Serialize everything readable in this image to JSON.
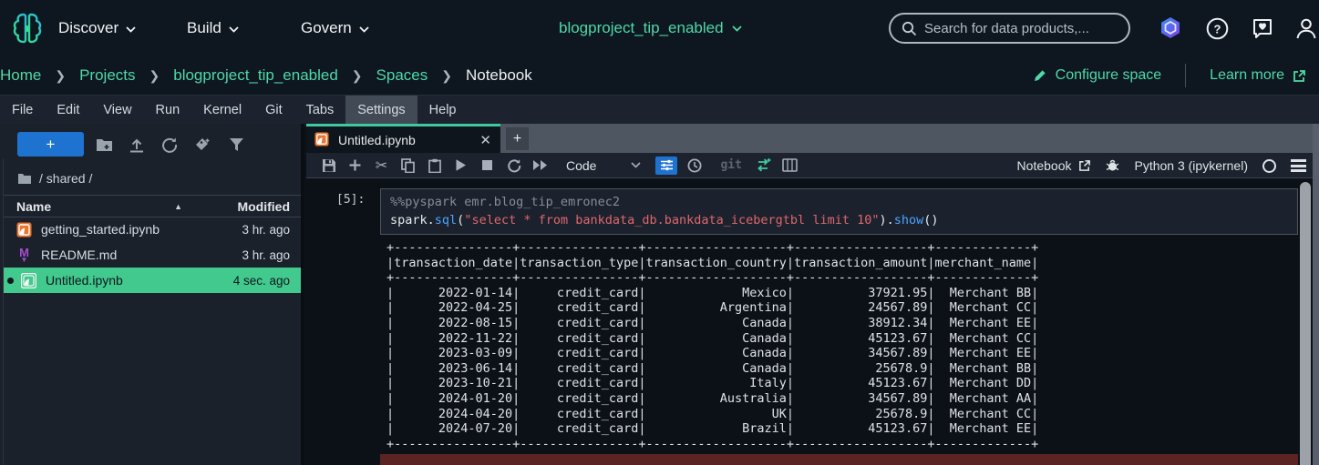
{
  "topnav": {
    "menus": [
      {
        "label": "Discover"
      },
      {
        "label": "Build"
      },
      {
        "label": "Govern"
      }
    ],
    "project_selector": "blogproject_tip_enabled",
    "search_placeholder": "Search for data products,...",
    "accent_color": "#4ed9a8"
  },
  "breadcrumb": {
    "items": [
      "Home",
      "Projects",
      "blogproject_tip_enabled",
      "Spaces",
      "Notebook"
    ],
    "configure_label": "Configure space",
    "learn_more_label": "Learn more"
  },
  "menubar": {
    "items": [
      "File",
      "Edit",
      "View",
      "Run",
      "Kernel",
      "Git",
      "Tabs",
      "Settings",
      "Help"
    ],
    "active_item": "Settings"
  },
  "sidebar": {
    "new_button_label": "+",
    "path": "/ shared /",
    "columns": {
      "name": "Name",
      "modified": "Modified"
    },
    "files": [
      {
        "name": "getting_started.ipynb",
        "modified": "3 hr. ago",
        "type": "notebook",
        "selected": false
      },
      {
        "name": "README.md",
        "modified": "3 hr. ago",
        "type": "markdown",
        "selected": false
      },
      {
        "name": "Untitled.ipynb",
        "modified": "4 sec. ago",
        "type": "notebook",
        "selected": true,
        "unsaved": true
      }
    ]
  },
  "editor": {
    "tab_title": "Untitled.ipynb",
    "cell_type_selector": "Code",
    "git_label": "git",
    "notebook_link_label": "Notebook",
    "kernel_name": "Python 3 (ipykernel)"
  },
  "cell": {
    "execution_count": "[5]:",
    "magic_line": "%%pyspark emr.blog_tip_emronec2",
    "tokens": [
      {
        "text": "spark",
        "type": "plain"
      },
      {
        "text": ".",
        "type": "plain"
      },
      {
        "text": "sql",
        "type": "fn"
      },
      {
        "text": "(",
        "type": "plain"
      },
      {
        "text": "\"select * from bankdata_db.bankdata_icebergtbl limit 10\"",
        "type": "str"
      },
      {
        "text": ")",
        "type": "plain"
      },
      {
        "text": ".",
        "type": "plain"
      },
      {
        "text": "show",
        "type": "fn"
      },
      {
        "text": "()",
        "type": "plain"
      }
    ]
  },
  "output_table": {
    "columns": [
      "transaction_date",
      "transaction_type",
      "transaction_country",
      "transaction_amount",
      "merchant_name"
    ],
    "rows": [
      [
        "2022-01-14",
        "credit_card",
        "Mexico",
        "37921.95",
        "Merchant BB"
      ],
      [
        "2022-04-25",
        "credit_card",
        "Argentina",
        "24567.89",
        "Merchant CC"
      ],
      [
        "2022-08-15",
        "credit_card",
        "Canada",
        "38912.34",
        "Merchant EE"
      ],
      [
        "2022-11-22",
        "credit_card",
        "Canada",
        "45123.67",
        "Merchant CC"
      ],
      [
        "2023-03-09",
        "credit_card",
        "Canada",
        "34567.89",
        "Merchant EE"
      ],
      [
        "2023-06-14",
        "credit_card",
        "Canada",
        "25678.9",
        "Merchant BB"
      ],
      [
        "2023-10-21",
        "credit_card",
        "Italy",
        "45123.67",
        "Merchant DD"
      ],
      [
        "2024-01-20",
        "credit_card",
        "Australia",
        "34567.89",
        "Merchant AA"
      ],
      [
        "2024-04-20",
        "credit_card",
        "UK",
        "25678.9",
        "Merchant CC"
      ],
      [
        "2024-07-20",
        "credit_card",
        "Brazil",
        "45123.67",
        "Merchant EE"
      ]
    ]
  }
}
